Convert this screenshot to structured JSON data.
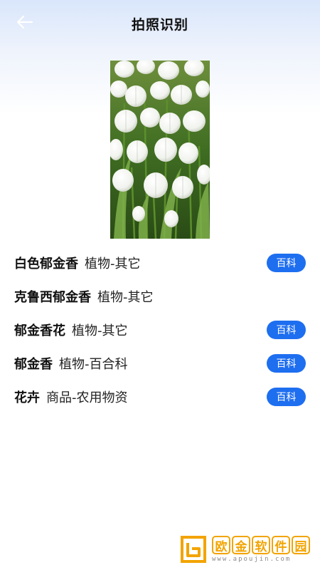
{
  "header": {
    "back_icon": "arrow-left-icon",
    "title": "拍照识别"
  },
  "photo": {
    "subject": "white tulips"
  },
  "results": [
    {
      "name": "白色郁金香",
      "category": "植物-其它",
      "button": "百科",
      "has_button": true
    },
    {
      "name": "克鲁西郁金香",
      "category": "植物-其它",
      "button": "",
      "has_button": false
    },
    {
      "name": "郁金香花",
      "category": "植物-其它",
      "button": "百科",
      "has_button": true
    },
    {
      "name": "郁金香",
      "category": "植物-百合科",
      "button": "百科",
      "has_button": true
    },
    {
      "name": "花卉",
      "category": "商品-农用物资",
      "button": "百科",
      "has_button": true
    }
  ],
  "watermark": {
    "chars": [
      "欧",
      "金",
      "软",
      "件",
      "园"
    ],
    "url": "www.apoujin.com"
  },
  "colors": {
    "accent": "#1e6ef0",
    "watermark": "#f2a400"
  }
}
